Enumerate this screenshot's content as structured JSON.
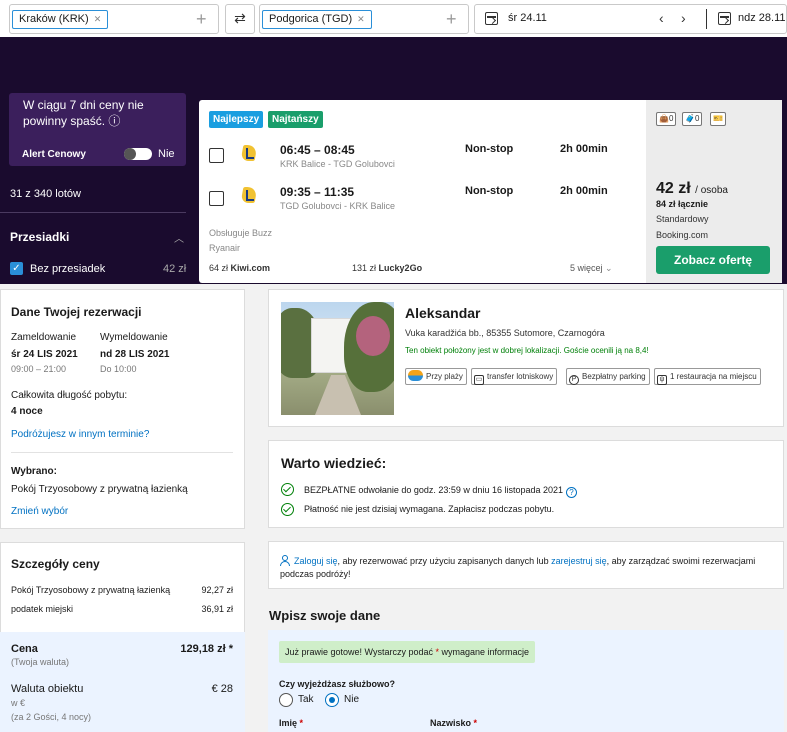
{
  "search": {
    "from_chip": "Kraków (KRK)",
    "to_chip": "Podgorica (TGD)",
    "depart_date": "śr 24.11",
    "return_date": "ndz 28.11"
  },
  "alert": {
    "message": "W ciągu 7 dni ceny nie powinny spaść.",
    "info_icon": "ⓘ",
    "label": "Alert Cenowy",
    "toggle_state": "Nie"
  },
  "results": {
    "count": "31 z 340 lotów",
    "filter_title": "Przesiadki",
    "filter_option": "Bez przesiadek",
    "filter_price": "42 zł"
  },
  "flight": {
    "tags": [
      "Najlepszy",
      "Najtańszy"
    ],
    "legs": [
      {
        "time": "06:45 – 08:45",
        "route": "KRK Balice - TGD Golubovci",
        "stops": "Non-stop",
        "duration": "2h 00min"
      },
      {
        "time": "09:35 – 11:35",
        "route": "TGD Golubovci - KRK Balice",
        "stops": "Non-stop",
        "duration": "2h 00min"
      }
    ],
    "operator": "Obsługuje Buzz",
    "airline": "Ryanair",
    "alt_prices": [
      {
        "price": "64 zł",
        "site": "Kiwi.com"
      },
      {
        "price": "131 zł",
        "site": "Lucky2Go"
      }
    ],
    "more": "5 więcej",
    "bags": [
      "0",
      "0"
    ],
    "price": "42 zł",
    "per": "/ osoba",
    "total": "84 zł łącznie",
    "fare": "Standardowy",
    "provider": "Booking.com",
    "cta": "Zobacz ofertę"
  },
  "reservation": {
    "title": "Dane Twojej rezerwacji",
    "checkin_label": "Zameldowanie",
    "checkout_label": "Wymeldowanie",
    "checkin_date": "śr 24 LIS 2021",
    "checkout_date": "nd 28 LIS 2021",
    "checkin_time": "09:00 – 21:00",
    "checkout_time": "Do 10:00",
    "stay_label": "Całkowita długość pobytu:",
    "stay_value": "4 noce",
    "other_dates_link": "Podróżujesz w innym terminie?",
    "selected_label": "Wybrano:",
    "selected_value": "Pokój Trzyosobowy z prywatną łazienką",
    "change_link": "Zmień wybór"
  },
  "price_details": {
    "title": "Szczegóły ceny",
    "rows": [
      {
        "label": "Pokój Trzyosobowy z prywatną łazienką",
        "value": "92,27 zł"
      },
      {
        "label": "podatek miejski",
        "value": "36,91 zł"
      }
    ],
    "total_label": "Cena",
    "total_sub": "(Twoja waluta)",
    "total_value": "129,18 zł *",
    "property_currency_label": "Waluta obiektu",
    "property_currency_sub": "w €",
    "property_currency_value": "€ 28",
    "guests_note": "(za 2 Gości,  4 nocy)"
  },
  "hotel": {
    "name": "Aleksandar",
    "address": "Vuka karadžića bb., 85355 Sutomore, Czarnogóra",
    "location_note": "Ten obiekt położony jest w dobrej lokalizacji. Goście ocenili ją na 8,4!",
    "facilities": [
      "Przy plaży",
      "transfer lotniskowy",
      "Bezpłatny parking",
      "1 restauracja na miejscu"
    ]
  },
  "good_to_know": {
    "title": "Warto wiedzieć:",
    "items": [
      "BEZPŁATNE odwołanie do godz. 23:59 w dniu 16 listopada 2021",
      "Płatność nie jest dzisiaj wymagana. Zapłacisz podczas pobytu."
    ]
  },
  "login_note": {
    "link1": "Zaloguj się",
    "text1": ", aby rezerwować przy użyciu zapisanych danych lub ",
    "link2": "zarejestruj się",
    "text2": ", aby zarządzać swoimi rezerwacjami podczas podróży!"
  },
  "form": {
    "title": "Wpisz swoje dane",
    "ready_prefix": "Już prawie gotowe! Wystarczy podać ",
    "ready_star": "*",
    "ready_suffix": " wymagane informacje",
    "business_q": "Czy wyjeżdżasz służbowo?",
    "yes": "Tak",
    "no": "Nie",
    "first_name": "Imię",
    "last_name": "Nazwisko",
    "star": "*"
  },
  "colors": {
    "dark_bg": "#1a0b2e",
    "alert_bg": "#3b1f5c",
    "cta_green": "#1a9e6b",
    "tag_blue": "#1a9ee0",
    "tag_green": "#1a9e6b",
    "link_blue": "#0071c2"
  }
}
